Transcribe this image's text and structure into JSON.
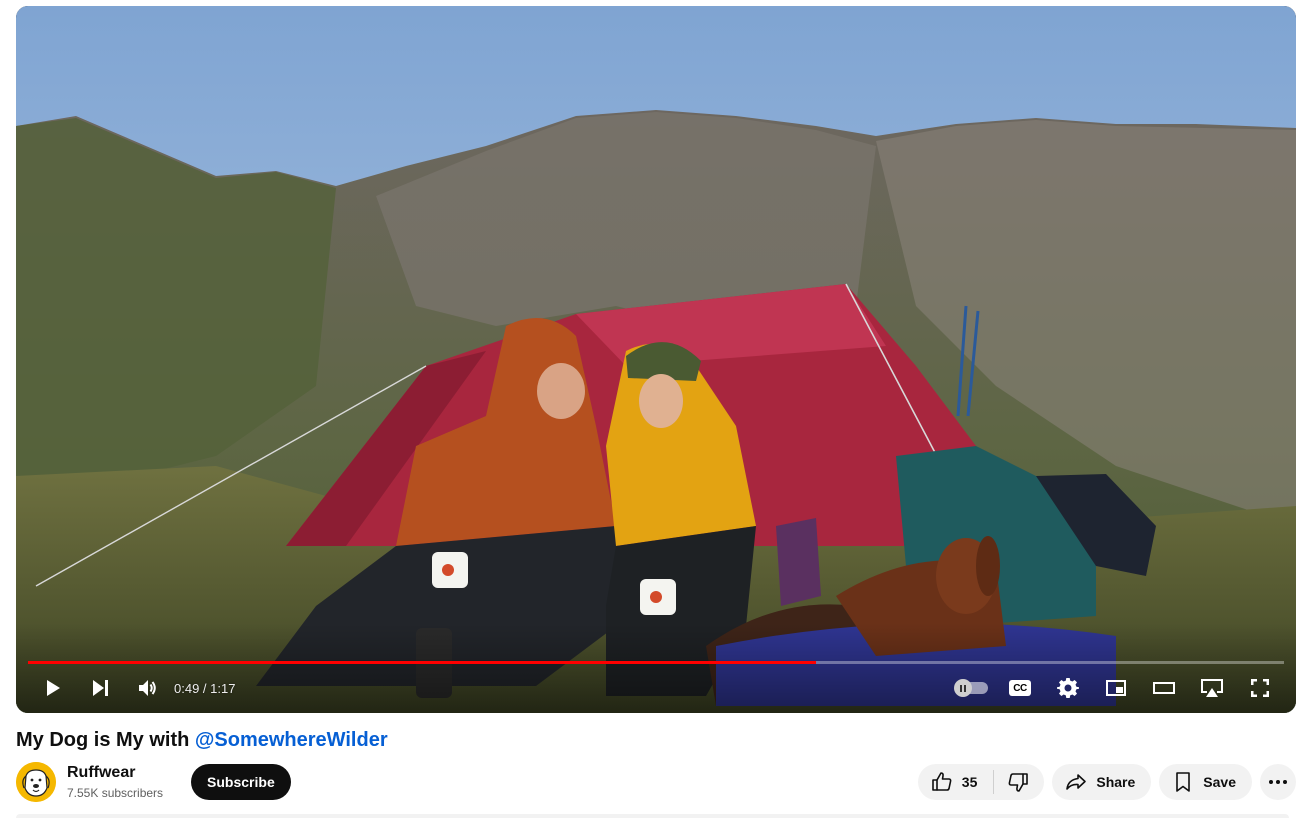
{
  "player": {
    "time_current": "0:49",
    "time_separator": " / ",
    "time_total": "1:17",
    "progress_fraction": 0.627,
    "accent_color": "#ff0000",
    "buttons": {
      "play": "play-icon",
      "next": "next-icon",
      "volume": "volume-icon",
      "autoplay": "autoplay-toggle",
      "captions": "CC",
      "settings": "gear-icon",
      "miniplayer": "miniplayer-icon",
      "theater": "theater-icon",
      "cast": "cast-icon",
      "fullscreen": "fullscreen-icon"
    }
  },
  "video": {
    "title_prefix": "My Dog is My with ",
    "title_mention": "@SomewhereWilder",
    "mention_color": "#065fd4"
  },
  "owner": {
    "channel_name": "Ruffwear",
    "subscribers": "7.55K subscribers",
    "subscribe_label": "Subscribe"
  },
  "actions": {
    "like_count": "35",
    "share_label": "Share",
    "save_label": "Save"
  }
}
